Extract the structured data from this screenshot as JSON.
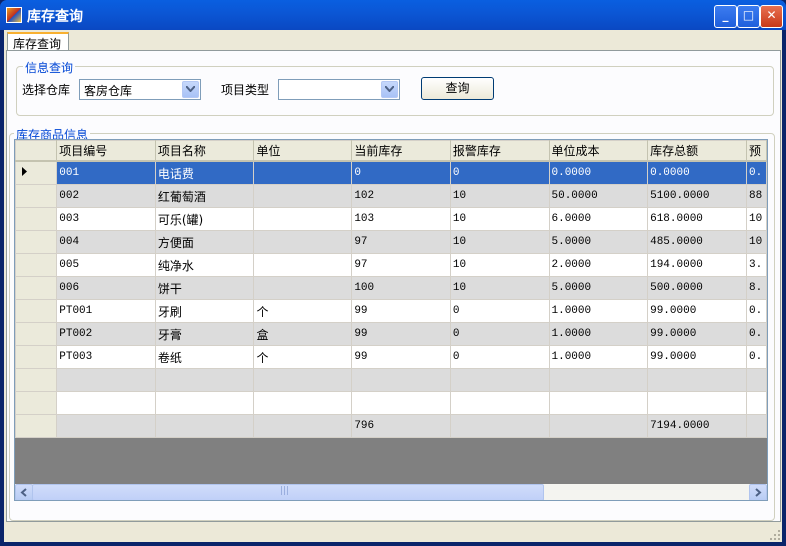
{
  "window": {
    "title": "库存查询",
    "buttons": {
      "minimize": "_",
      "maximize": "□",
      "close": "✕"
    }
  },
  "tab": {
    "label": "库存查询"
  },
  "query_group": {
    "legend": "信息查询",
    "warehouse_label": "选择仓库",
    "warehouse_value": "客房仓库",
    "type_label": "项目类型",
    "type_value": "",
    "query_button": "查询"
  },
  "goods_group": {
    "legend": "库存商品信息"
  },
  "grid": {
    "columns": [
      "项目编号",
      "项目名称",
      "单位",
      "当前库存",
      "报警库存",
      "单位成本",
      "库存总额",
      "预"
    ],
    "rows": [
      [
        "001",
        "电话费",
        "",
        "0",
        "0",
        "0.0000",
        "0.0000",
        "0."
      ],
      [
        "002",
        "红葡萄酒",
        "",
        "102",
        "10",
        "50.0000",
        "5100.0000",
        "88"
      ],
      [
        "003",
        "可乐(罐)",
        "",
        "103",
        "10",
        "6.0000",
        "618.0000",
        "10"
      ],
      [
        "004",
        "方便面",
        "",
        "97",
        "10",
        "5.0000",
        "485.0000",
        "10"
      ],
      [
        "005",
        "纯净水",
        "",
        "97",
        "10",
        "2.0000",
        "194.0000",
        "3."
      ],
      [
        "006",
        "饼干",
        "",
        "100",
        "10",
        "5.0000",
        "500.0000",
        "8."
      ],
      [
        "PT001",
        "牙刷",
        "个",
        "99",
        "0",
        "1.0000",
        "99.0000",
        "0."
      ],
      [
        "PT002",
        "牙膏",
        "盒",
        "99",
        "0",
        "1.0000",
        "99.0000",
        "0."
      ],
      [
        "PT003",
        "卷纸",
        "个",
        "99",
        "0",
        "1.0000",
        "99.0000",
        "0."
      ],
      [
        "",
        "",
        "",
        "",
        "",
        "",
        "",
        ""
      ],
      [
        "",
        "",
        "",
        "",
        "",
        "",
        "",
        ""
      ],
      [
        "",
        "",
        "",
        "796",
        "",
        "",
        "7194.0000",
        ""
      ]
    ],
    "selected_row": 0
  },
  "scrollbar": {
    "thumb_grip": "|||"
  }
}
